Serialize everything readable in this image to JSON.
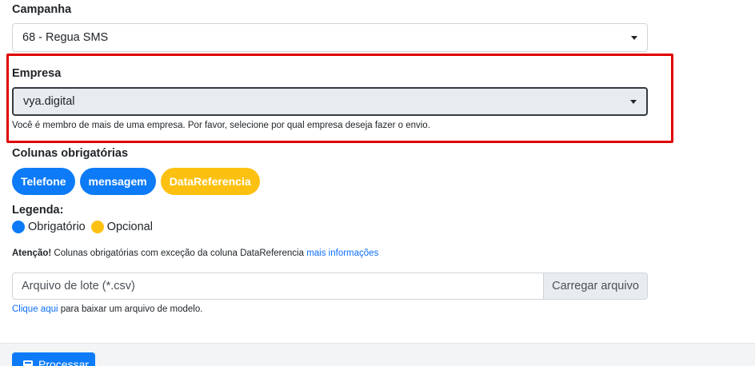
{
  "campanha": {
    "label": "Campanha",
    "selected": "68 - Regua SMS"
  },
  "empresa": {
    "label": "Empresa",
    "selected": "vya.digital",
    "help": "Você é membro de mais de uma empresa. Por favor, selecione por qual empresa deseja fazer o envio."
  },
  "colunas": {
    "label": "Colunas obrigatórias",
    "pills": [
      {
        "label": "Telefone",
        "color": "#0d7bf7"
      },
      {
        "label": "mensagem",
        "color": "#0d7bf7"
      },
      {
        "label": "DataReferencia",
        "color": "#fcc110"
      }
    ]
  },
  "legenda": {
    "label": "Legenda:",
    "items": [
      {
        "label": "Obrigatório",
        "color": "#0d7bf7"
      },
      {
        "label": "Opcional",
        "color": "#fcc110"
      }
    ]
  },
  "atencao": {
    "strong": "Atenção!",
    "text": " Colunas obrigatórias com exceção da coluna DataReferencia ",
    "link": "mais informações"
  },
  "arquivo": {
    "placeholder": "Arquivo de lote (*.csv)",
    "button": "Carregar arquivo",
    "help_link": "Clique aqui",
    "help_text": " para baixar um arquivo de modelo."
  },
  "actions": {
    "process_label": "Processar"
  },
  "colors": {
    "highlight": "#e00000",
    "primary": "#0d7bf7",
    "warning": "#fcc110"
  }
}
